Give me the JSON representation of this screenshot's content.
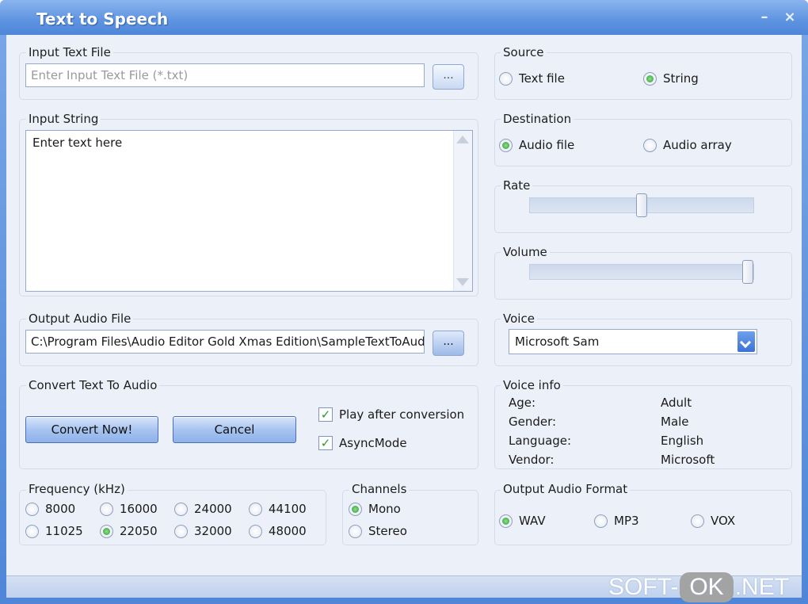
{
  "window": {
    "title": "Text to Speech",
    "minimize_glyph": "–",
    "close_glyph": "×"
  },
  "input_file": {
    "label": "Input Text File",
    "placeholder": "Enter Input Text File (*.txt)",
    "value": "",
    "browse_label": "..."
  },
  "input_string": {
    "label": "Input String",
    "value": "Enter text here"
  },
  "output_file": {
    "label": "Output Audio File",
    "value": "C:\\Program Files\\Audio Editor Gold Xmas Edition\\SampleTextToAudio",
    "browse_label": "..."
  },
  "convert": {
    "label": "Convert Text To Audio",
    "convert_button": "Convert Now!",
    "cancel_button": "Cancel",
    "play_after": {
      "label": "Play after conversion",
      "checked": true
    },
    "async_mode": {
      "label": "AsyncMode",
      "checked": true
    },
    "check_glyph": "✓"
  },
  "frequency": {
    "label": "Frequency (kHz)",
    "options": [
      "8000",
      "16000",
      "24000",
      "44100",
      "11025",
      "22050",
      "32000",
      "48000"
    ],
    "selected": "22050"
  },
  "channels": {
    "label": "Channels",
    "options": [
      "Mono",
      "Stereo"
    ],
    "selected": "Mono"
  },
  "source": {
    "label": "Source",
    "options": [
      "Text file",
      "String"
    ],
    "selected": "String"
  },
  "destination": {
    "label": "Destination",
    "options": [
      "Audio file",
      "Audio array"
    ],
    "selected": "Audio file"
  },
  "rate": {
    "label": "Rate",
    "level": 0.5
  },
  "volume": {
    "label": "Volume",
    "level": 1.0
  },
  "voice": {
    "label": "Voice",
    "selected": "Microsoft Sam"
  },
  "voice_info": {
    "label": "Voice info",
    "rows": [
      {
        "key": "Age:",
        "value": "Adult"
      },
      {
        "key": "Gender:",
        "value": "Male"
      },
      {
        "key": "Language:",
        "value": "English"
      },
      {
        "key": "Vendor:",
        "value": "Microsoft"
      }
    ]
  },
  "output_format": {
    "label": "Output Audio Format",
    "options": [
      "WAV",
      "MP3",
      "VOX"
    ],
    "selected": "WAV"
  },
  "watermark": {
    "left": "SOFT-",
    "mid": "OK",
    "right": ".NET"
  },
  "colors": {
    "title_bar": "#5d93e0",
    "client": "#ecf0f8",
    "radio_on": "#2e9a2e",
    "button": "#a8c4f0"
  }
}
